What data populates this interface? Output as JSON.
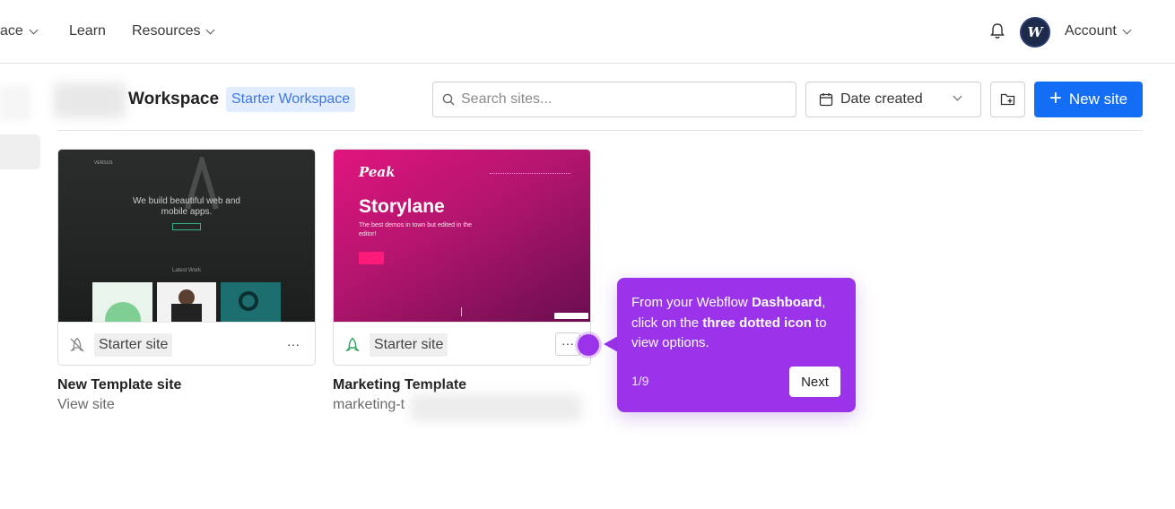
{
  "nav": {
    "marketplace_fragment": "ace",
    "learn": "Learn",
    "resources": "Resources",
    "avatar_letter": "W",
    "account": "Account"
  },
  "workspace": {
    "title": "Workspace",
    "badge": "Starter Workspace"
  },
  "toolbar": {
    "search_placeholder": "Search sites...",
    "sort_label": "Date created",
    "new_site_label": "New site",
    "new_site_plus": "+"
  },
  "sites": [
    {
      "name": "New Template site",
      "subtitle": "View site",
      "status": "Starter site",
      "more": "···",
      "thumb": {
        "brand": "VERSUS",
        "headline_1": "We build beautiful web and",
        "headline_2": "mobile apps.",
        "section": "Latest Work"
      }
    },
    {
      "name": "Marketing Template",
      "subtitle": "marketing-t",
      "status": "Starter site",
      "more": "···",
      "thumb": {
        "logo": "Peak",
        "title": "Storylane",
        "tagline": "The best demos in town but edited in the editor!"
      }
    }
  ],
  "tooltip": {
    "text_1": "From your Webflow ",
    "bold_1": "Dashboard",
    "text_2": ", click on the ",
    "bold_2": "three dotted icon",
    "text_3": " to view options.",
    "step": "1/9",
    "next": "Next"
  },
  "colors": {
    "primary": "#146ef5",
    "tooltip": "#9a33ea",
    "badge_bg": "#e1ecff",
    "badge_text": "#3e77e0"
  }
}
